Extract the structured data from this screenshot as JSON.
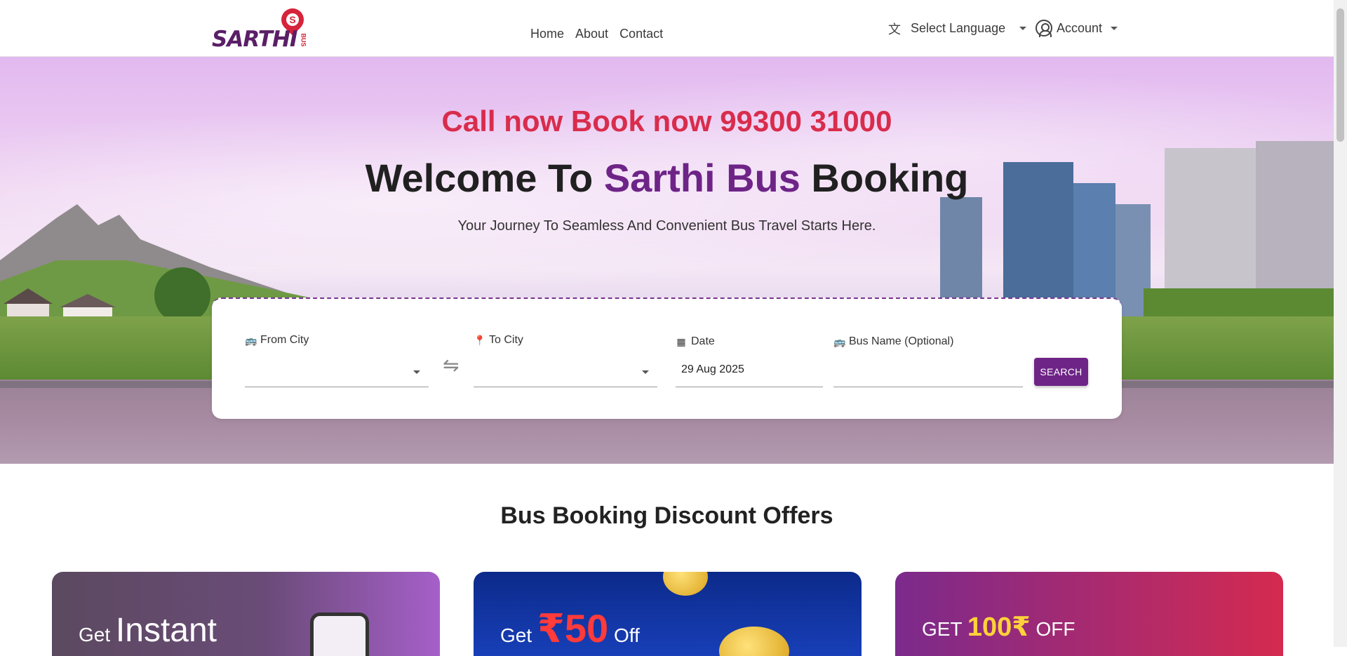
{
  "header": {
    "logo_text": "SARTHI",
    "logo_sub": "BUS",
    "nav": [
      "Home",
      "About",
      "Contact"
    ],
    "language_label": "Select Language",
    "account_label": "Account"
  },
  "hero": {
    "call_line": "Call now Book now 99300 31000",
    "welcome_pre": "Welcome To ",
    "welcome_accent": "Sarthi Bus",
    "welcome_post": " Booking",
    "tagline": "Your Journey To Seamless And Convenient Bus Travel Starts Here."
  },
  "search": {
    "from_label": "From City",
    "from_value": "",
    "to_label": "To City",
    "to_value": "",
    "date_label": "Date",
    "date_value": "29 Aug 2025",
    "bus_label": "Bus Name (Optional)",
    "bus_value": "",
    "button_label": "SEARCH"
  },
  "offers": {
    "title": "Bus Booking Discount Offers",
    "cards": [
      {
        "pre": "Get",
        "main": "Instant"
      },
      {
        "pre": "Get",
        "amount": "₹50",
        "post": "Off"
      },
      {
        "pre": "GET",
        "amount": "100₹",
        "post": "OFF"
      }
    ]
  },
  "colors": {
    "brand_purple": "#6e2487",
    "brand_red": "#d92c4c"
  }
}
